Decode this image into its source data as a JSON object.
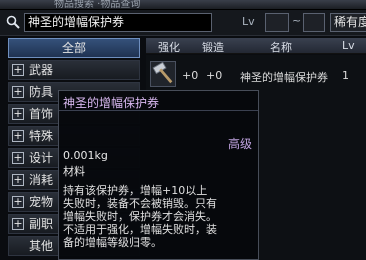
{
  "window": {
    "title": "物品搜索 ·物品查询"
  },
  "search": {
    "value": "神圣的增幅保护券",
    "lv_label": "Lv",
    "lv_separator": "~",
    "rarity_label": "稀有度"
  },
  "sidebar": {
    "categories": [
      {
        "label": "全部"
      },
      {
        "label": "武器"
      },
      {
        "label": "防具"
      },
      {
        "label": "首饰"
      },
      {
        "label": "特殊"
      },
      {
        "label": "设计"
      },
      {
        "label": "消耗"
      },
      {
        "label": "宠物"
      },
      {
        "label": "副职"
      },
      {
        "label": "其他"
      }
    ]
  },
  "list": {
    "headers": {
      "enhance": "强化",
      "forge": "锻造",
      "name": "名称",
      "lv": "Lv"
    },
    "rows": [
      {
        "enhance": "+0",
        "forge": "+0",
        "name": "神圣的增幅保护券",
        "lv": "1"
      }
    ]
  },
  "tooltip": {
    "name": "神圣的增幅保护券",
    "rarity": "高级",
    "weight": "0.001kg",
    "type": "材料",
    "description": [
      "持有该保护券，增幅+10以上",
      "失败时，装备不会被销毁。只有",
      "增幅失败时，保护券才会消失。",
      "不适用于强化，增幅失败时，装",
      "备的增幅等级归零。"
    ]
  },
  "icons": {
    "search": "search-icon",
    "item": "hammer-icon",
    "expand": "plus-icon"
  },
  "colors": {
    "item_name": "#d8b8f0",
    "rarity": "#c0a3e0",
    "selected_category": "#35517a"
  }
}
